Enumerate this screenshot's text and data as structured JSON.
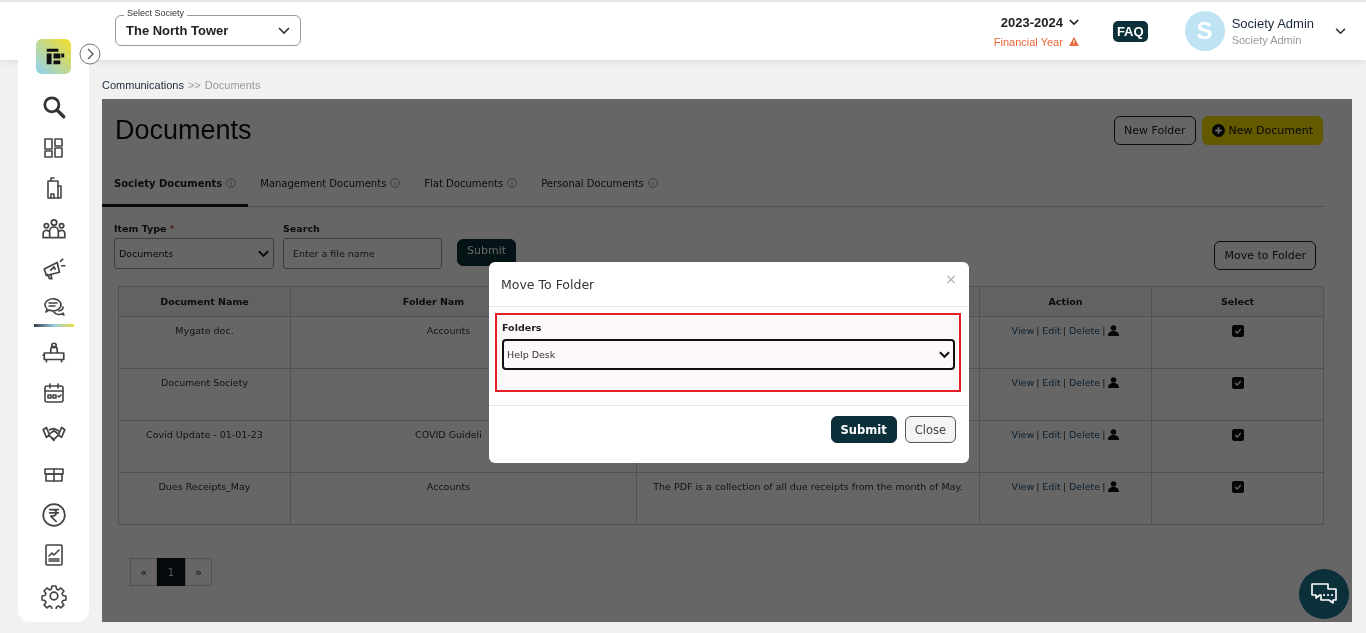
{
  "header": {
    "society_select": {
      "label": "Select Society",
      "value": "The North Tower"
    },
    "year": {
      "value": "2023-2024",
      "caption": "Financial Year"
    },
    "faq": "FAQ",
    "user": {
      "initial": "S",
      "name": "Society Admin",
      "role": "Society Admin"
    }
  },
  "sidebar": {
    "items": [
      {
        "kind": "search",
        "selected": false
      },
      {
        "kind": "dashboard",
        "selected": false
      },
      {
        "kind": "building",
        "selected": false
      },
      {
        "kind": "people",
        "selected": false
      },
      {
        "kind": "megaphone",
        "selected": false
      },
      {
        "kind": "chat",
        "selected": true
      },
      {
        "kind": "desk",
        "selected": false
      },
      {
        "kind": "calendar",
        "selected": false
      },
      {
        "kind": "handshake",
        "selected": false
      },
      {
        "kind": "gift",
        "selected": false
      },
      {
        "kind": "rupee",
        "selected": false
      },
      {
        "kind": "report",
        "selected": false
      },
      {
        "kind": "settings",
        "selected": false
      }
    ]
  },
  "breadcrumb": {
    "parent": "Communications",
    "separator": ">>",
    "current": "Documents"
  },
  "page": {
    "title": "Documents",
    "buttons": [
      {
        "kind": "outline",
        "label": "New Folder"
      },
      {
        "kind": "primary",
        "label": "New Document"
      }
    ],
    "tabs": [
      {
        "label": "Society Documents",
        "selected": true
      },
      {
        "label": "Management Documents",
        "selected": false
      },
      {
        "label": "Flat Documents",
        "selected": false
      },
      {
        "label": "Personal Documents",
        "selected": false
      }
    ],
    "filters": {
      "item_type": {
        "label": "Item Type",
        "required_mark": "*",
        "value": "Documents"
      },
      "search": {
        "label": "Search",
        "placeholder": "Enter a file name"
      },
      "submit": "Submit",
      "move_button": "Move to Folder"
    },
    "table": {
      "columns": [
        {
          "label": "Document Name"
        },
        {
          "label": "Folder Nam"
        },
        {},
        {
          "label": "Action"
        },
        {
          "label": "Select"
        }
      ],
      "rows": [
        {
          "document_name": "Mygate doc.",
          "folder_name": "Accounts",
          "actions": [
            "View",
            "Edit",
            "Delete"
          ],
          "selected": true
        },
        {
          "document_name": "Document Society",
          "actions": [
            "View",
            "Edit",
            "Delete"
          ],
          "selected": true
        },
        {
          "document_name": "Covid Update - 01-01-23",
          "folder_name": "COVID Guideli",
          "actions": [
            "View",
            "Edit",
            "Delete"
          ],
          "selected": true
        },
        {
          "document_name": "Dues Receipts_May",
          "folder_name": "Accounts",
          "description": "The PDF is a collection of all due receipts from the month of May.",
          "actions": [
            "View",
            "Edit",
            "Delete"
          ],
          "selected": true
        }
      ],
      "action_separator": "|"
    },
    "pagination": {
      "prev": "«",
      "pages": [
        {
          "label": "1",
          "selected": true
        }
      ],
      "next": "»"
    }
  },
  "modal": {
    "title": "Move To Folder",
    "close_glyph": "×",
    "field": {
      "label": "Folders",
      "value": "Help Desk",
      "highlighted": true
    },
    "buttons": [
      {
        "kind": "primary",
        "label": "Submit"
      },
      {
        "kind": "secondary",
        "label": "Close"
      }
    ]
  }
}
